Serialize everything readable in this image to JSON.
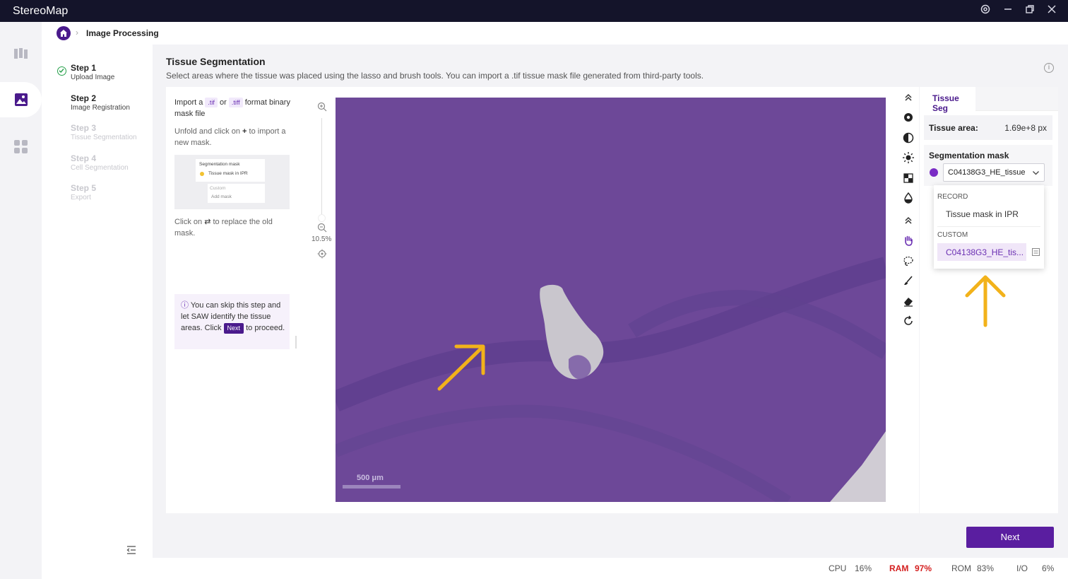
{
  "app": {
    "title": "StereoMap"
  },
  "breadcrumb": {
    "current": "Image Processing"
  },
  "steps": [
    {
      "title": "Step 1",
      "subtitle": "Upload Image",
      "state": "done"
    },
    {
      "title": "Step 2",
      "subtitle": "Image Registration",
      "state": "current"
    },
    {
      "title": "Step 3",
      "subtitle": "Tissue Segmentation",
      "state": "pending"
    },
    {
      "title": "Step 4",
      "subtitle": "Cell Segmentation",
      "state": "pending"
    },
    {
      "title": "Step 5",
      "subtitle": "Export",
      "state": "pending"
    }
  ],
  "page": {
    "title": "Tissue Segmentation",
    "description": "Select areas where the tissue was placed using the lasso and brush tools. You can import a .tif tissue mask file generated from third-party tools."
  },
  "help": {
    "import_prefix": "Import a",
    "tif": ".tif",
    "or": "or",
    "tiff": ".tiff",
    "import_suffix": "format binary mask file",
    "unfold_prefix": "Unfold and click on",
    "unfold_suffix": "to import a new mask.",
    "mini_title": "Segmentation mask",
    "mini_option": "Tissue mask in IPR",
    "mini_custom": "Custom",
    "mini_add": "Add mask",
    "replace_prefix": "Click on",
    "replace_suffix": "to replace the old mask.",
    "skip_prefix": "You can skip this step and let SAW identify the tissue areas. Click",
    "skip_next": "Next",
    "skip_suffix": "to proceed."
  },
  "viewer": {
    "zoom": "10.5%",
    "scale_label": "500 μm"
  },
  "panel": {
    "tab": "Tissue Seg",
    "area_label": "Tissue area:",
    "area_value": "1.69e+8 px",
    "mask_title": "Segmentation mask",
    "mask_selected": "C04138G3_HE_tissue"
  },
  "dropdown": {
    "record_label": "RECORD",
    "record_item": "Tissue mask in IPR",
    "custom_label": "CUSTOM",
    "custom_item": "C04138G3_HE_tis..."
  },
  "actions": {
    "next": "Next"
  },
  "status": {
    "cpu_label": "CPU",
    "cpu_value": "16%",
    "ram_label": "RAM",
    "ram_value": "97%",
    "rom_label": "ROM",
    "rom_value": "83%",
    "io_label": "I/O",
    "io_value": "6%"
  },
  "colors": {
    "brand": "#4a1a8c",
    "accent": "#7a2cc5",
    "annotation_arrow": "#f2b21a",
    "ram_alert": "#d42020"
  }
}
